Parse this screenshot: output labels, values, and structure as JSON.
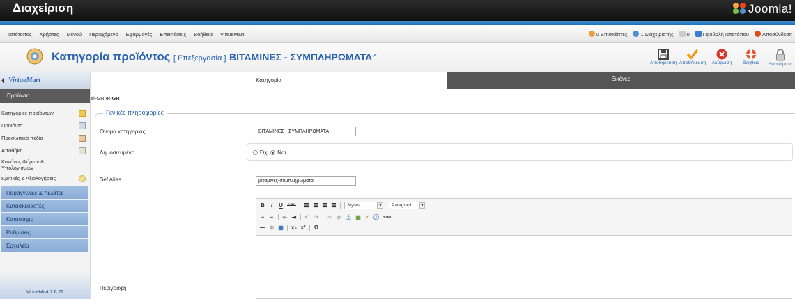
{
  "topbar": {
    "title": "Διαχείριση",
    "brand": "Joomla!"
  },
  "menu": {
    "items": [
      "Ιστότοπος",
      "Χρήστες",
      "Μενού",
      "Περιεχόμενο",
      "Εφαρμογές",
      "Επεκτάσεις",
      "Βοήθεια",
      "VirtueMart"
    ]
  },
  "status": {
    "visitors": "0 Επισκέπτες",
    "admins": "1 Διαχειριστής",
    "messages": "0",
    "view_site": "Προβολή Ιστοτόπου",
    "logout": "Αποσύνδεση"
  },
  "header": {
    "title": "Κατηγορία προϊόντος",
    "mode": "[ Επεξεργασία ]",
    "name": "ΒΙΤΑΜΙΝΕΣ - ΣΥΜΠΛΗΡΩΜΑΤΑ"
  },
  "toolbar": {
    "buttons": [
      "Αποθήκευση",
      "Αποθήκευση",
      "Ακύρωση",
      "Βοήθεια",
      "Δικαιώματα"
    ]
  },
  "sidebar": {
    "logo": "VirtueMart",
    "section": "Προϊόντα",
    "items": [
      "Κατηγορίες προϊόντων",
      "Προϊόντα",
      "Προσωπικά πεδία",
      "Αποθήκη",
      "Κανόνες Φόρων & Υπολογισμών",
      "Κριτικές & Αξιολογήσεις"
    ],
    "groups": [
      "Παραγγελίες & πελάτες",
      "Κατασκευαστές",
      "Κατάστημα",
      "Ρυθμίσεις",
      "Εργαλεία"
    ],
    "version": "VirtueMart 2.6.22"
  },
  "tabs": {
    "category": "Κατηγορία",
    "images": "Εικόνες"
  },
  "lang": {
    "prefix": "el-GR",
    "code": "el-GR"
  },
  "form": {
    "legend": "Γενικές πληροφορίες",
    "name_label": "Ονομα κατηγορίας",
    "name_value": "ΒΙΤΑΜΙΝΕΣ - ΣΥΜΠΛΗΡΩΜΑΤΑ",
    "published_label": "Δημοσιευμένο",
    "no": "Όχι",
    "yes": "Ναι",
    "alias_label": "Sef Alias",
    "alias_value": "βιταμινες-συμπληρωματα",
    "desc_label": "Περιγραφή"
  },
  "editor": {
    "styles": "Styles",
    "format": "Paragraph",
    "html_btn": "HTML"
  }
}
